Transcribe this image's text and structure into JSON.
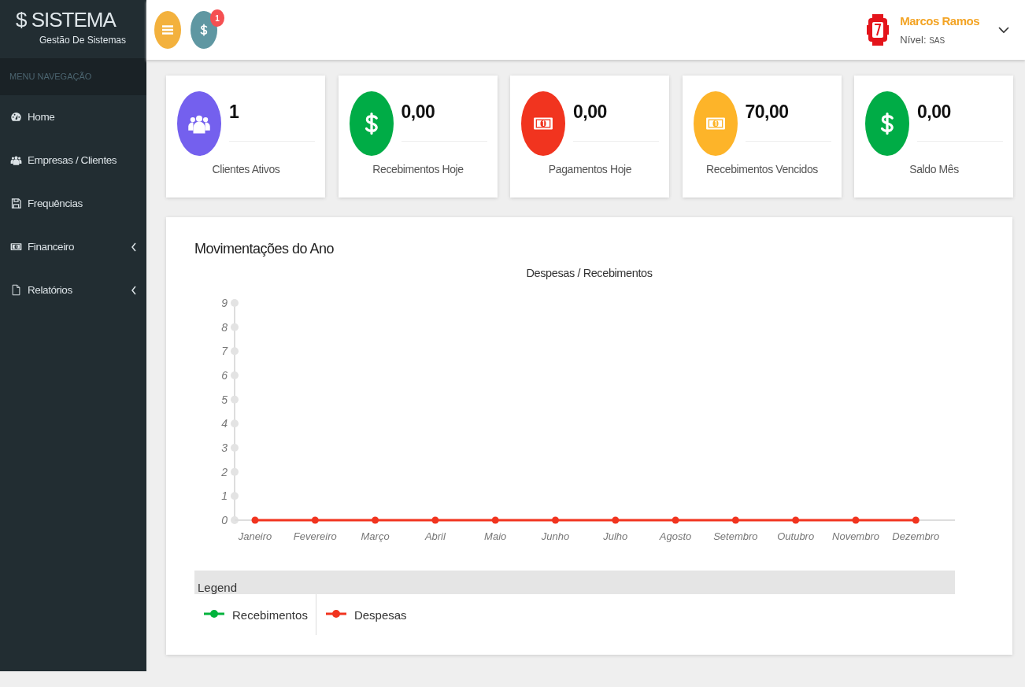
{
  "brand": {
    "title": "$ SISTEMA",
    "subtitle": "Gestão De Sistemas"
  },
  "sidebar": {
    "header": "MENU NAVEGAÇÃO",
    "items": [
      {
        "label": "Home",
        "kind": "dashboard",
        "has_submenu": false
      },
      {
        "label": "Empresas / Clientes",
        "kind": "users",
        "has_submenu": false
      },
      {
        "label": "Frequências",
        "kind": "save",
        "has_submenu": false
      },
      {
        "label": "Financeiro",
        "kind": "money",
        "has_submenu": true
      },
      {
        "label": "Relatórios",
        "kind": "file",
        "has_submenu": true
      }
    ]
  },
  "topbar": {
    "notification_count": "1",
    "user": {
      "name": "Marcos Ramos",
      "level_label": "Nível:",
      "level": "SAS"
    }
  },
  "stats": [
    {
      "value": "1",
      "label": "Clientes Ativos",
      "kind": "users",
      "color": "#7460ee"
    },
    {
      "value": "0,00",
      "label": "Recebimentos Hoje",
      "kind": "dollar",
      "color": "#00ac46"
    },
    {
      "value": "0,00",
      "label": "Pagamentos Hoje",
      "kind": "money",
      "color": "#f1341f"
    },
    {
      "value": "70,00",
      "label": "Recebimentos Vencidos",
      "kind": "money",
      "color": "#fdb429"
    },
    {
      "value": "0,00",
      "label": "Saldo Mês",
      "kind": "dollar",
      "color": "#00ac46"
    }
  ],
  "chart_panel": {
    "heading": "Movimentações do Ano",
    "legend_title": "Legend",
    "chart_data": {
      "type": "line",
      "title": "Despesas / Recebimentos",
      "categories": [
        "Janeiro",
        "Fevereiro",
        "Março",
        "Abril",
        "Maio",
        "Junho",
        "Julho",
        "Agosto",
        "Setembro",
        "Outubro",
        "Novembro",
        "Dezembro"
      ],
      "series": [
        {
          "name": "Recebimentos",
          "color": "#00b33c",
          "marker": "circle",
          "values": [
            null,
            null,
            null,
            null,
            null,
            null,
            null,
            null,
            null,
            null,
            null,
            null
          ]
        },
        {
          "name": "Despesas",
          "color": "#f1341f",
          "marker": "circle",
          "values": [
            0,
            0,
            0,
            0,
            0,
            0,
            0,
            0,
            0,
            0,
            0,
            0
          ]
        }
      ],
      "ylim": [
        0,
        9
      ],
      "yticks": [
        0,
        1,
        2,
        3,
        4,
        5,
        6,
        7,
        8,
        9
      ]
    }
  }
}
